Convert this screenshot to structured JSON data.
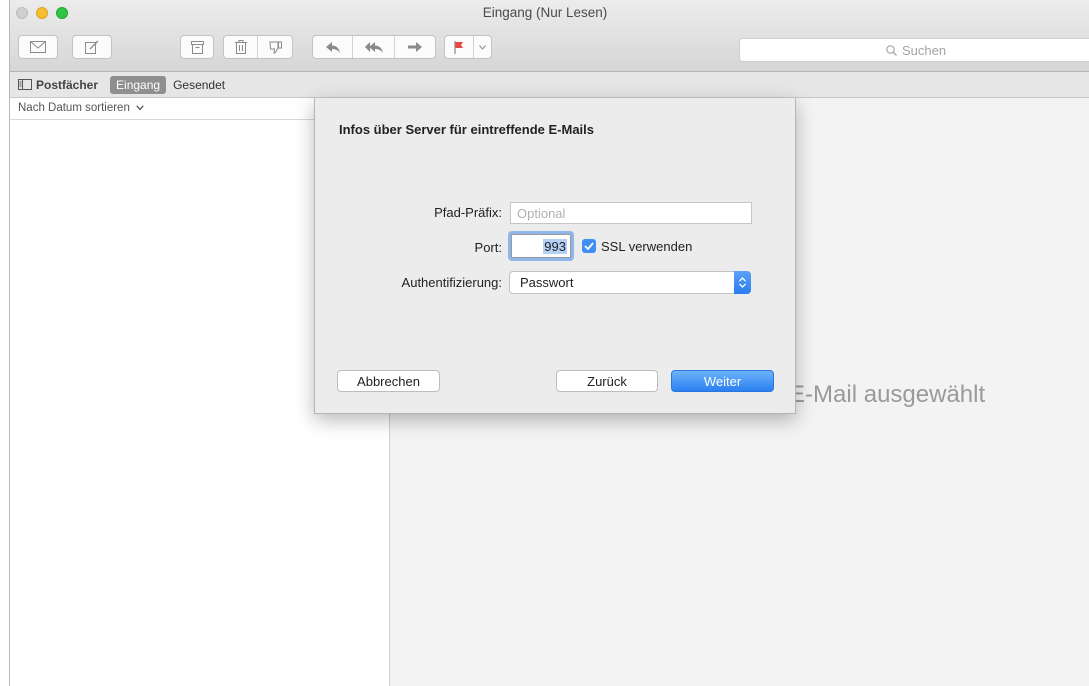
{
  "window": {
    "title": "Eingang (Nur Lesen)"
  },
  "toolbar": {
    "search_placeholder": "Suchen"
  },
  "favorites": {
    "mailboxes_label": "Postfächer",
    "items": [
      {
        "label": "Eingang",
        "selected": true
      },
      {
        "label": "Gesendet",
        "selected": false
      }
    ]
  },
  "message_list": {
    "sort_label": "Nach Datum sortieren"
  },
  "content": {
    "empty_message": "Keine E-Mail ausgewählt"
  },
  "sheet": {
    "title": "Infos über Server für eintreffende E-Mails",
    "path_prefix": {
      "label": "Pfad-Präfix:",
      "placeholder": "Optional",
      "value": ""
    },
    "port": {
      "label": "Port:",
      "value": "993"
    },
    "ssl": {
      "label": "SSL verwenden",
      "checked": true
    },
    "auth": {
      "label": "Authentifizierung:",
      "value": "Passwort"
    },
    "buttons": {
      "cancel": "Abbrechen",
      "back": "Zurück",
      "next": "Weiter"
    }
  },
  "colors": {
    "accent": "#3f8ef5",
    "flag": "#e8483f",
    "selected_mailbox": "#8f8f8f"
  }
}
